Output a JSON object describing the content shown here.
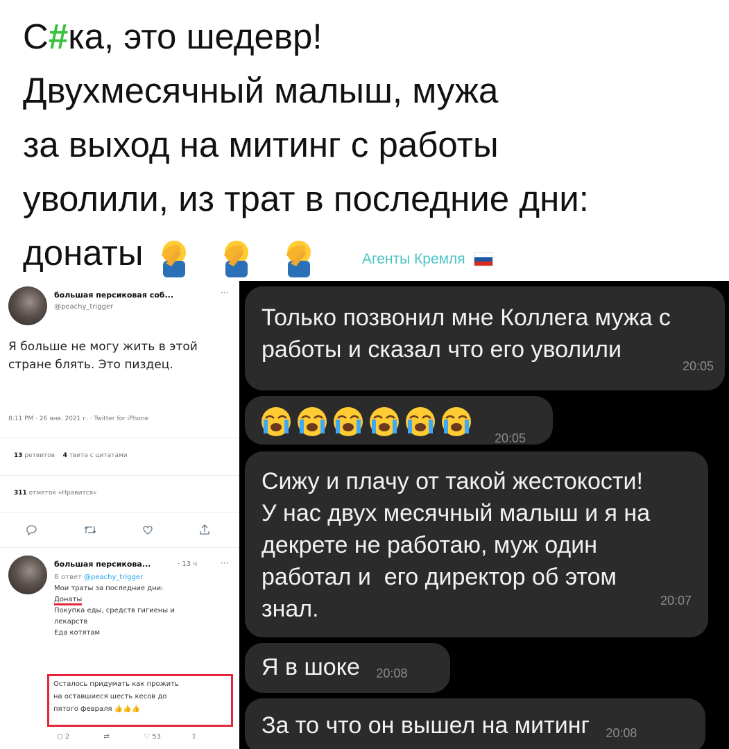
{
  "headline": {
    "line1_prefix": "С",
    "line1_censor": "#",
    "line1_suffix": "ка, это шедевр!",
    "line2": "Двухмесячный малыш, мужа",
    "line3": "за выход на митинг с работы",
    "line4": "уволили, из трат в последние дни:",
    "line5": "донаты",
    "emojis": [
      "facepalm-emoji",
      "facepalm-emoji",
      "facepalm-emoji"
    ]
  },
  "watermark": {
    "text": "Агенты Кремля",
    "flag": "russia-flag",
    "colors": [
      "#ffffff",
      "#1c57a5",
      "#d52b1e"
    ]
  },
  "tweet": {
    "name": "большая персиковая соб...",
    "handle": "@peachy_trigger",
    "more": "···",
    "body": "Я больше не могу жить в этой стране блять. Это пиздец.",
    "meta": "8:11 PM · 26 янв. 2021 г. · Twitter for iPhone",
    "retweets_count": "13",
    "retweets_label": "ретвитов",
    "quotes_count": "4",
    "quotes_label": "твита с цитатами",
    "likes_count": "311",
    "likes_label": "отметок «Нравится»",
    "actions": [
      "reply-icon",
      "retweet-icon",
      "like-icon",
      "share-icon"
    ]
  },
  "reply": {
    "name": "большая персикова...",
    "time": "· 13 ч",
    "more": "···",
    "reply_prefix": "В ответ",
    "reply_handle": "@peachy_trigger",
    "line1": "Мои траты за последние дни:",
    "line2": "Донаты",
    "line3": "Покупка еды, средств гигиены и",
    "line4": "лекарств",
    "line5": "Еда котятам",
    "boxed1": "Осталось придумать как прожить",
    "boxed2": "на оставшиеся шесть кесов до",
    "boxed3": "пятого февраля",
    "thumbs": "👍👍👍",
    "reply_count": "2",
    "like_count": "53"
  },
  "chat": {
    "messages": [
      {
        "text1": "Только позвонил мне Коллега мужа с",
        "text2": "работы и сказал что его уволили",
        "time": "20:05"
      },
      {
        "emoji": "crying-face-emoji",
        "count": 6,
        "time": "20:05"
      },
      {
        "text1": "Сижу и плачу от такой жестокости!",
        "text2": "У нас двух месячный малыш и я на",
        "text3": "декрете не работаю, муж один",
        "text4": "работал и  его директор об этом",
        "text5": "знал.",
        "time": "20:07"
      },
      {
        "text1": "Я в шоке",
        "time": "20:08"
      },
      {
        "text1": "За то что он вышел на митинг",
        "time": "20:08"
      }
    ]
  }
}
